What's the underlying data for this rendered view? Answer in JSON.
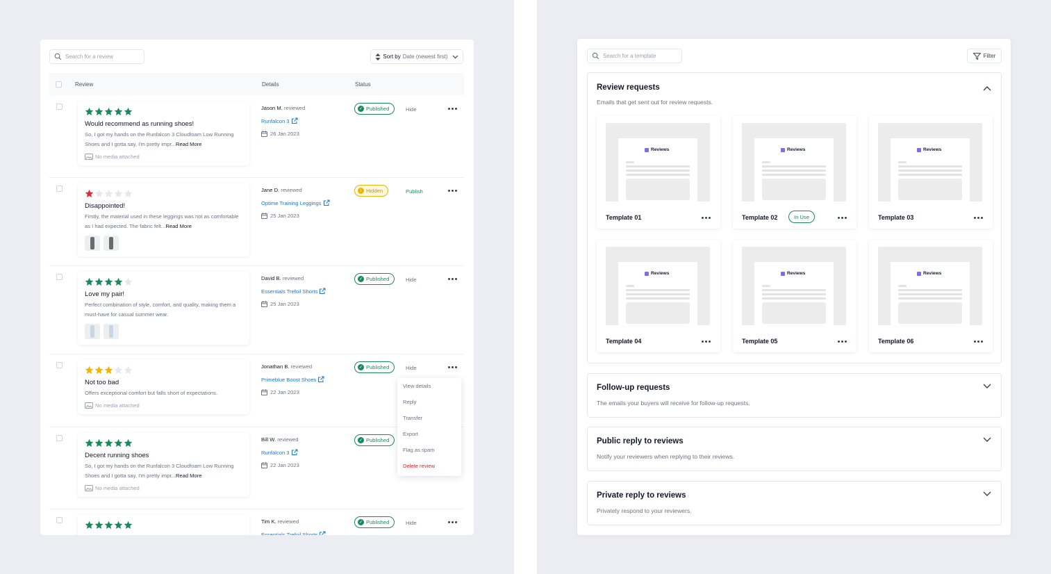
{
  "reviews_panel": {
    "search_placeholder": "Search for a review",
    "sort": {
      "label": "Sort by",
      "value": "Date (newest first)"
    },
    "columns": {
      "review": "Review",
      "details": "Details",
      "status": "Status"
    },
    "rows": [
      {
        "rating": 5,
        "title": "Would recommend as running shoes!",
        "body": "So, I got my hands on the Runfalcon 3 Cloudfoam Low Running Shoes and I gotta say, I'm pretty impr...",
        "read_more": "Read More",
        "media": "No media attached",
        "reviewer": "Jason M.",
        "reviewed": "reviewed",
        "product": "Runfalcon 3",
        "date": "26 Jan 2023",
        "status": "Published",
        "action": "Hide"
      },
      {
        "rating": 1,
        "title": "Disappointed!",
        "body": "Firstly, the material used in these leggings was not as comfortable as I had expected. The fabric felt...",
        "read_more": "Read More",
        "media": "",
        "reviewer": "Jane D.",
        "reviewed": "reviewed",
        "product": "Optime Training Leggings",
        "date": "25 Jan 2023",
        "status": "Hidden",
        "action": "Publish"
      },
      {
        "rating": 4,
        "title": "Love my pair!",
        "body": "Perfect combination of style, comfort, and quality, making them a must-have for casual summer wear.",
        "read_more": "",
        "media": "",
        "reviewer": "David B.",
        "reviewed": "reviewed",
        "product": "Essentials Trefoil Shorts",
        "date": "25 Jan 2023",
        "status": "Published",
        "action": "Hide"
      },
      {
        "rating": 3,
        "title": "Not too bad",
        "body": "Offers exceptional comfort but falls short of expectations.",
        "read_more": "",
        "media": "No media attached",
        "reviewer": "Jonathan B.",
        "reviewed": "reviewed",
        "product": "Primeblue Boost Shoes",
        "date": "22 Jan 2023",
        "status": "Published",
        "action": "Hide"
      },
      {
        "rating": 5,
        "title": "Decent running shoes",
        "body": "So, I got my hands on the Runfalcon 3 Cloudfoam Low Running Shoes and I gotta say, I'm pretty impr...",
        "read_more": "Read More",
        "media": "No media attached",
        "reviewer": "Bill W.",
        "reviewed": "reviewed",
        "product": "Runfalcon 3",
        "date": "22 Jan 2023",
        "status": "Published",
        "action": ""
      },
      {
        "rating": 5,
        "title": "",
        "body": "",
        "read_more": "",
        "media": "",
        "reviewer": "Tim K.",
        "reviewed": "reviewed",
        "product": "Essentials Trefoil Shorts",
        "date": "",
        "status": "Published",
        "action": "Hide"
      }
    ],
    "context_menu": [
      "View details",
      "Reply",
      "Transfer",
      "Export",
      "Flag as spam",
      "Delete review"
    ]
  },
  "templates_panel": {
    "search_placeholder": "Search for a template",
    "filter_label": "Filter",
    "sections": [
      {
        "title": "Review requests",
        "desc": "Emails that get sent out for review requests.",
        "expanded": true
      },
      {
        "title": "Follow-up requests",
        "desc": "The emails your buyers will receive for follow-up requests.",
        "expanded": false
      },
      {
        "title": "Public reply to reviews",
        "desc": "Notify your reviewers when replying to their reviews.",
        "expanded": false
      },
      {
        "title": "Private reply to reviews",
        "desc": "Privately respond to your reviewers.",
        "expanded": false
      }
    ],
    "templates": [
      {
        "name": "Template 01",
        "in_use": false
      },
      {
        "name": "Template 02",
        "in_use": true
      },
      {
        "name": "Template 03",
        "in_use": false
      },
      {
        "name": "Template 04",
        "in_use": false
      },
      {
        "name": "Template 05",
        "in_use": false
      },
      {
        "name": "Template 06",
        "in_use": false
      }
    ],
    "in_use_label": "In Use",
    "preview_brand": "Reviews"
  },
  "colors": {
    "green": "#1a8a5a",
    "star_green": "#1a8a5a",
    "star_red": "#e5283a",
    "star_yellow": "#f4b400",
    "star_empty": "#e5e7eb",
    "link": "#2276c6",
    "danger": "#dc2626",
    "brand": "#7c6cf0"
  }
}
